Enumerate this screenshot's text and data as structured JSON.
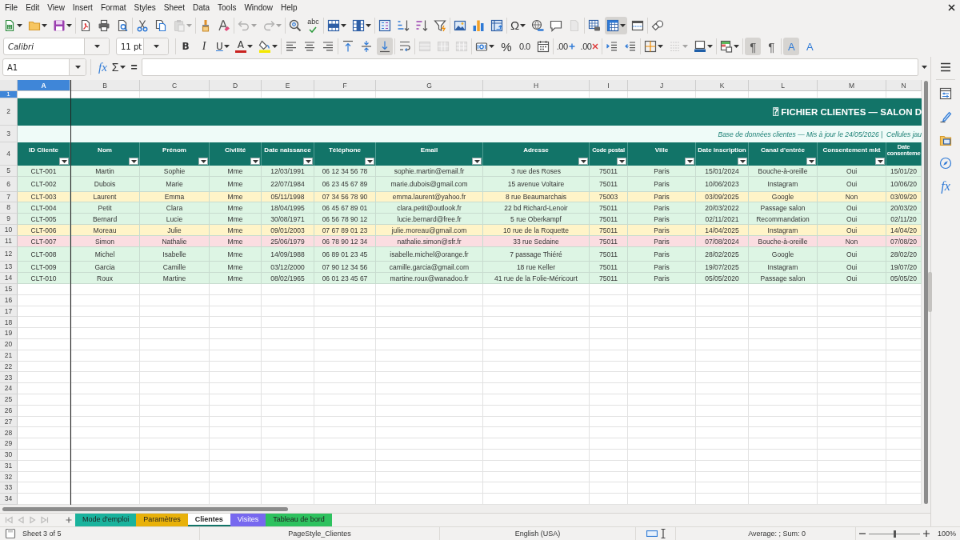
{
  "menu": [
    "File",
    "Edit",
    "View",
    "Insert",
    "Format",
    "Styles",
    "Sheet",
    "Data",
    "Tools",
    "Window",
    "Help"
  ],
  "standard_toolbar": [
    [
      {
        "kind": "new",
        "dropdown": true,
        "on": false,
        "disabled": false
      },
      {
        "kind": "open",
        "dropdown": true,
        "on": false,
        "disabled": false
      },
      {
        "kind": "save",
        "dropdown": true,
        "on": false,
        "disabled": false
      }
    ],
    [
      {
        "kind": "pdf",
        "dropdown": false,
        "on": false,
        "disabled": false
      },
      {
        "kind": "print",
        "dropdown": false,
        "on": false,
        "disabled": false
      },
      {
        "kind": "preview",
        "dropdown": false,
        "on": false,
        "disabled": false
      }
    ],
    [
      {
        "kind": "cut",
        "dropdown": false,
        "on": false,
        "disabled": false
      },
      {
        "kind": "copy",
        "dropdown": false,
        "on": false,
        "disabled": false
      },
      {
        "kind": "paste",
        "dropdown": true,
        "on": false,
        "disabled": true
      }
    ],
    [
      {
        "kind": "clone",
        "dropdown": false,
        "on": false,
        "disabled": false
      },
      {
        "kind": "clear",
        "dropdown": false,
        "on": false,
        "disabled": false
      }
    ],
    [
      {
        "kind": "undo",
        "dropdown": true,
        "on": false,
        "disabled": true
      },
      {
        "kind": "redo",
        "dropdown": true,
        "on": false,
        "disabled": true
      }
    ],
    [
      {
        "kind": "find",
        "dropdown": false,
        "on": false,
        "disabled": false
      },
      {
        "kind": "spelling",
        "label": "abc",
        "dropdown": false,
        "on": false,
        "disabled": false
      }
    ],
    [
      {
        "kind": "rows",
        "dropdown": true,
        "on": false,
        "disabled": false
      },
      {
        "kind": "columns",
        "dropdown": true,
        "on": false,
        "disabled": false
      }
    ],
    [
      {
        "kind": "sort",
        "dropdown": false,
        "on": false,
        "disabled": false
      },
      {
        "kind": "ascending",
        "dropdown": false,
        "on": false,
        "disabled": false
      },
      {
        "kind": "descending",
        "dropdown": false,
        "on": false,
        "disabled": false
      },
      {
        "kind": "autofilter",
        "dropdown": false,
        "on": false,
        "disabled": false
      }
    ],
    [
      {
        "kind": "image",
        "dropdown": false,
        "on": false,
        "disabled": false
      },
      {
        "kind": "chart",
        "dropdown": false,
        "on": false,
        "disabled": false
      },
      {
        "kind": "pivot",
        "dropdown": false,
        "on": false,
        "disabled": false
      }
    ],
    [
      {
        "kind": "special",
        "label": "Ω",
        "dropdown": true,
        "on": false,
        "disabled": false
      },
      {
        "kind": "hyperlink",
        "dropdown": false,
        "on": false,
        "disabled": false
      },
      {
        "kind": "comment",
        "dropdown": false,
        "on": false,
        "disabled": false
      },
      {
        "kind": "headerfooter",
        "dropdown": false,
        "on": false,
        "disabled": true
      }
    ],
    [
      {
        "kind": "printarea",
        "dropdown": false,
        "on": false,
        "disabled": false
      },
      {
        "kind": "freeze",
        "dropdown": true,
        "on": true,
        "disabled": false
      },
      {
        "kind": "split",
        "dropdown": false,
        "on": false,
        "disabled": false
      }
    ],
    [
      {
        "kind": "draw",
        "dropdown": false,
        "on": false,
        "disabled": false
      }
    ]
  ],
  "formatting_toolbar": {
    "font_name": "Calibri",
    "font_size": "11 pt",
    "groups": [
      [
        {
          "kind": "bold",
          "label": "B",
          "dropdown": false,
          "on": false,
          "disabled": false
        },
        {
          "kind": "italic",
          "label": "I",
          "dropdown": false,
          "on": false,
          "disabled": false
        },
        {
          "kind": "underline",
          "label": "U",
          "dropdown": true,
          "on": false,
          "disabled": false
        },
        {
          "kind": "fontcolor",
          "label": "A",
          "dropdown": true,
          "on": false,
          "disabled": false
        },
        {
          "kind": "highlight",
          "dropdown": true,
          "on": false,
          "disabled": false
        }
      ],
      [
        {
          "kind": "left",
          "dropdown": false,
          "on": false,
          "disabled": false
        },
        {
          "kind": "center",
          "dropdown": false,
          "on": false,
          "disabled": false
        },
        {
          "kind": "right",
          "dropdown": false,
          "on": false,
          "disabled": false
        }
      ],
      [
        {
          "kind": "top",
          "dropdown": false,
          "on": false,
          "disabled": false
        },
        {
          "kind": "middle",
          "dropdown": false,
          "on": false,
          "disabled": false
        },
        {
          "kind": "bottom",
          "dropdown": false,
          "on": true,
          "disabled": false
        }
      ],
      [
        {
          "kind": "wrap",
          "dropdown": false,
          "on": false,
          "disabled": false
        }
      ],
      [
        {
          "kind": "mergecenter",
          "dropdown": false,
          "on": false,
          "disabled": true
        },
        {
          "kind": "merge",
          "dropdown": false,
          "on": false,
          "disabled": true
        },
        {
          "kind": "unmerge",
          "dropdown": false,
          "on": false,
          "disabled": true
        }
      ],
      [
        {
          "kind": "currency",
          "dropdown": true,
          "on": false,
          "disabled": false
        },
        {
          "kind": "percent",
          "label": "%",
          "dropdown": false,
          "on": false,
          "disabled": false
        },
        {
          "kind": "standard",
          "label": "0.0",
          "dropdown": false,
          "on": false,
          "disabled": false
        },
        {
          "kind": "date",
          "dropdown": false,
          "on": false,
          "disabled": false
        }
      ],
      [
        {
          "kind": "adddecimal",
          "label": ".00",
          "dropdown": false,
          "on": false,
          "disabled": false
        },
        {
          "kind": "deletedecimal",
          "label": ".00",
          "dropdown": false,
          "on": false,
          "disabled": false
        }
      ],
      [
        {
          "kind": "indent",
          "dropdown": false,
          "on": false,
          "disabled": false
        },
        {
          "kind": "outdent",
          "dropdown": false,
          "on": false,
          "disabled": false
        }
      ],
      [
        {
          "kind": "borders",
          "dropdown": true,
          "on": false,
          "disabled": false
        },
        {
          "kind": "borderstyle",
          "dropdown": true,
          "on": false,
          "disabled": true
        },
        {
          "kind": "bordercolor",
          "dropdown": true,
          "on": false,
          "disabled": false
        }
      ],
      [
        {
          "kind": "conditional",
          "dropdown": true,
          "on": false,
          "disabled": false
        }
      ],
      [
        {
          "kind": "ltr",
          "label": "¶",
          "dropdown": false,
          "on": true,
          "disabled": false
        },
        {
          "kind": "rtl",
          "label": "¶",
          "dropdown": false,
          "on": false,
          "disabled": false
        }
      ],
      [
        {
          "kind": "horizontal",
          "label": "A",
          "dropdown": false,
          "on": true,
          "disabled": false
        },
        {
          "kind": "vertical",
          "label": "A",
          "dropdown": false,
          "on": false,
          "disabled": false
        }
      ]
    ]
  },
  "formula_bar": {
    "name_box": "A1",
    "wizard": "fx",
    "sum": "Σ",
    "equals": "="
  },
  "sheet": {
    "columns": [
      {
        "label": "A",
        "selected": true
      },
      {
        "label": "B",
        "selected": false
      },
      {
        "label": "C",
        "selected": false
      },
      {
        "label": "D",
        "selected": false
      },
      {
        "label": "E",
        "selected": false
      },
      {
        "label": "F",
        "selected": false
      },
      {
        "label": "G",
        "selected": false
      },
      {
        "label": "H",
        "selected": false
      },
      {
        "label": "I",
        "selected": false
      },
      {
        "label": "J",
        "selected": false
      },
      {
        "label": "K",
        "selected": false
      },
      {
        "label": "L",
        "selected": false
      },
      {
        "label": "M",
        "selected": false
      },
      {
        "label": "N",
        "selected": false
      }
    ],
    "rows": [
      {
        "label": "1",
        "selected": true
      },
      {
        "label": "2",
        "selected": false
      },
      {
        "label": "3",
        "selected": false
      },
      {
        "label": "4",
        "selected": false
      },
      {
        "label": "5",
        "selected": false
      },
      {
        "label": "6",
        "selected": false
      },
      {
        "label": "7",
        "selected": false
      },
      {
        "label": "8",
        "selected": false
      },
      {
        "label": "9",
        "selected": false
      },
      {
        "label": "10",
        "selected": false
      },
      {
        "label": "11",
        "selected": false
      },
      {
        "label": "12",
        "selected": false
      },
      {
        "label": "13",
        "selected": false
      },
      {
        "label": "14",
        "selected": false
      },
      {
        "label": "15",
        "selected": false
      },
      {
        "label": "16",
        "selected": false
      },
      {
        "label": "17",
        "selected": false
      },
      {
        "label": "18",
        "selected": false
      },
      {
        "label": "19",
        "selected": false
      },
      {
        "label": "20",
        "selected": false
      },
      {
        "label": "21",
        "selected": false
      },
      {
        "label": "22",
        "selected": false
      },
      {
        "label": "23",
        "selected": false
      },
      {
        "label": "24",
        "selected": false
      },
      {
        "label": "25",
        "selected": false
      },
      {
        "label": "26",
        "selected": false
      },
      {
        "label": "27",
        "selected": false
      },
      {
        "label": "28",
        "selected": false
      },
      {
        "label": "29",
        "selected": false
      },
      {
        "label": "30",
        "selected": false
      },
      {
        "label": "31",
        "selected": false
      },
      {
        "label": "32",
        "selected": false
      },
      {
        "label": "33",
        "selected": false
      },
      {
        "label": "34",
        "selected": false
      }
    ],
    "title": "⍰ FICHIER CLIENTES — SALON D",
    "subtitle": "Base de données clientes — Mis à jour le 24/05/2026 |  Cellules jau",
    "headers": [
      {
        "text": "ID Cliente",
        "filter": true
      },
      {
        "text": "Nom",
        "filter": true
      },
      {
        "text": "Prénom",
        "filter": true
      },
      {
        "text": "Civilité",
        "filter": true
      },
      {
        "text": "Date naissance",
        "filter": true
      },
      {
        "text": "Téléphone",
        "filter": true
      },
      {
        "text": "Email",
        "filter": true
      },
      {
        "text": "Adresse",
        "filter": true
      },
      {
        "text": "Code postal",
        "filter": true
      },
      {
        "text": "Ville",
        "filter": true
      },
      {
        "text": "Date inscription",
        "filter": true
      },
      {
        "text": "Canal d'entrée",
        "filter": true
      },
      {
        "text": "Consentement mkt",
        "filter": true
      },
      {
        "text": "Date consenteme",
        "filter": false
      }
    ],
    "records": [
      {
        "color": "#ddf5e4",
        "cells": [
          "CLT-001",
          "Martin",
          "Sophie",
          "Mme",
          "12/03/1991",
          "06 12 34 56 78",
          "sophie.martin@email.fr",
          "3 rue des Roses",
          "75011",
          "Paris",
          "15/01/2024",
          "Bouche-à-oreille",
          "Oui",
          "15/01/20"
        ]
      },
      {
        "color": "#ddf5e4",
        "cells": [
          "CLT-002",
          "Dubois",
          "Marie",
          "Mme",
          "22/07/1984",
          "06 23 45 67 89",
          "marie.dubois@gmail.com",
          "15 avenue Voltaire",
          "75011",
          "Paris",
          "10/06/2023",
          "Instagram",
          "Oui",
          "10/06/20"
        ]
      },
      {
        "color": "#fff4c8",
        "cells": [
          "CLT-003",
          "Laurent",
          "Emma",
          "Mme",
          "05/11/1998",
          "07 34 56 78 90",
          "emma.laurent@yahoo.fr",
          "8 rue Beaumarchais",
          "75003",
          "Paris",
          "03/09/2025",
          "Google",
          "Non",
          "03/09/20"
        ]
      },
      {
        "color": "#ddf5e4",
        "cells": [
          "CLT-004",
          "Petit",
          "Clara",
          "Mme",
          "18/04/1995",
          "06 45 67 89 01",
          "clara.petit@outlook.fr",
          "22 bd Richard-Lenoir",
          "75011",
          "Paris",
          "20/03/2022",
          "Passage salon",
          "Oui",
          "20/03/20"
        ]
      },
      {
        "color": "#ddf5e4",
        "cells": [
          "CLT-005",
          "Bernard",
          "Lucie",
          "Mme",
          "30/08/1971",
          "06 56 78 90 12",
          "lucie.bernard@free.fr",
          "5 rue Oberkampf",
          "75011",
          "Paris",
          "02/11/2021",
          "Recommandation",
          "Oui",
          "02/11/20"
        ]
      },
      {
        "color": "#fff4c8",
        "cells": [
          "CLT-006",
          "Moreau",
          "Julie",
          "Mme",
          "09/01/2003",
          "07 67 89 01 23",
          "julie.moreau@gmail.com",
          "10 rue de la Roquette",
          "75011",
          "Paris",
          "14/04/2025",
          "Instagram",
          "Oui",
          "14/04/20"
        ]
      },
      {
        "color": "#fbdde1",
        "cells": [
          "CLT-007",
          "Simon",
          "Nathalie",
          "Mme",
          "25/06/1979",
          "06 78 90 12 34",
          "nathalie.simon@sfr.fr",
          "33 rue Sedaine",
          "75011",
          "Paris",
          "07/08/2024",
          "Bouche-à-oreille",
          "Non",
          "07/08/20"
        ]
      },
      {
        "color": "#ddf5e4",
        "cells": [
          "CLT-008",
          "Michel",
          "Isabelle",
          "Mme",
          "14/09/1988",
          "06 89 01 23 45",
          "isabelle.michel@orange.fr",
          "7 passage Thiéré",
          "75011",
          "Paris",
          "28/02/2025",
          "Google",
          "Oui",
          "28/02/20"
        ]
      },
      {
        "color": "#ddf5e4",
        "cells": [
          "CLT-009",
          "Garcia",
          "Camille",
          "Mme",
          "03/12/2000",
          "07 90 12 34 56",
          "camille.garcia@gmail.com",
          "18 rue Keller",
          "75011",
          "Paris",
          "19/07/2025",
          "Instagram",
          "Oui",
          "19/07/20"
        ]
      },
      {
        "color": "#ddf5e4",
        "cells": [
          "CLT-010",
          "Roux",
          "Martine",
          "Mme",
          "08/02/1965",
          "06 01 23 45 67",
          "martine.roux@wanadoo.fr",
          "41 rue de la Folie-Méricourt",
          "75011",
          "Paris",
          "05/05/2020",
          "Passage salon",
          "Oui",
          "05/05/20"
        ]
      }
    ]
  },
  "sidebar": [
    {
      "kind": "menu"
    },
    {
      "kind": "properties"
    },
    {
      "kind": "styles"
    },
    {
      "kind": "gallery"
    },
    {
      "kind": "navigator"
    },
    {
      "kind": "functions",
      "label": "fx"
    }
  ],
  "sheet_tabs": {
    "navigation_disabled": true,
    "tabs": [
      {
        "label": "Mode d'emploi",
        "color": "#1ab39d",
        "selected": false
      },
      {
        "label": "Paramètres",
        "color": "#e8b10a",
        "selected": false
      },
      {
        "label": "Clientes",
        "color": "#127468",
        "selected": true
      },
      {
        "label": "Visites",
        "color": "#7768ef",
        "selected": false
      },
      {
        "label": "Tableau de bord",
        "color": "#2ec25f",
        "selected": false
      }
    ]
  },
  "status_bar": {
    "sheet": "Sheet 3 of 5",
    "page_style": "PageStyle_Clientes",
    "language": "English (USA)",
    "summary": "Average: ; Sum: 0",
    "zoom_slider": {
      "level": 0.5
    },
    "zoom": "100%"
  }
}
